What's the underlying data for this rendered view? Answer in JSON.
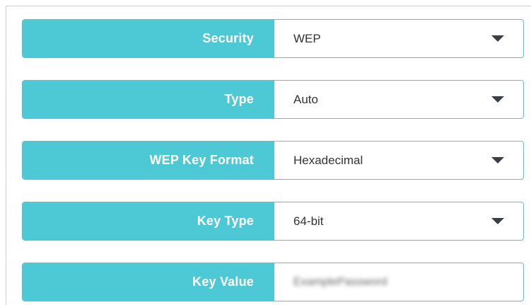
{
  "form": {
    "rows": [
      {
        "label": "Security",
        "value": "WEP",
        "type": "select"
      },
      {
        "label": "Type",
        "value": "Auto",
        "type": "select"
      },
      {
        "label": "WEP Key Format",
        "value": "Hexadecimal",
        "type": "select"
      },
      {
        "label": "Key Type",
        "value": "64-bit",
        "type": "select"
      },
      {
        "label": "Key Value",
        "value": "ExamplePassword",
        "type": "input"
      }
    ]
  },
  "colors": {
    "accent": "#4dc9d6",
    "label_text": "#ffffff",
    "value_text": "#333333",
    "caret": "#3a3f45"
  },
  "icons": {
    "dropdown": "caret-down-icon"
  }
}
